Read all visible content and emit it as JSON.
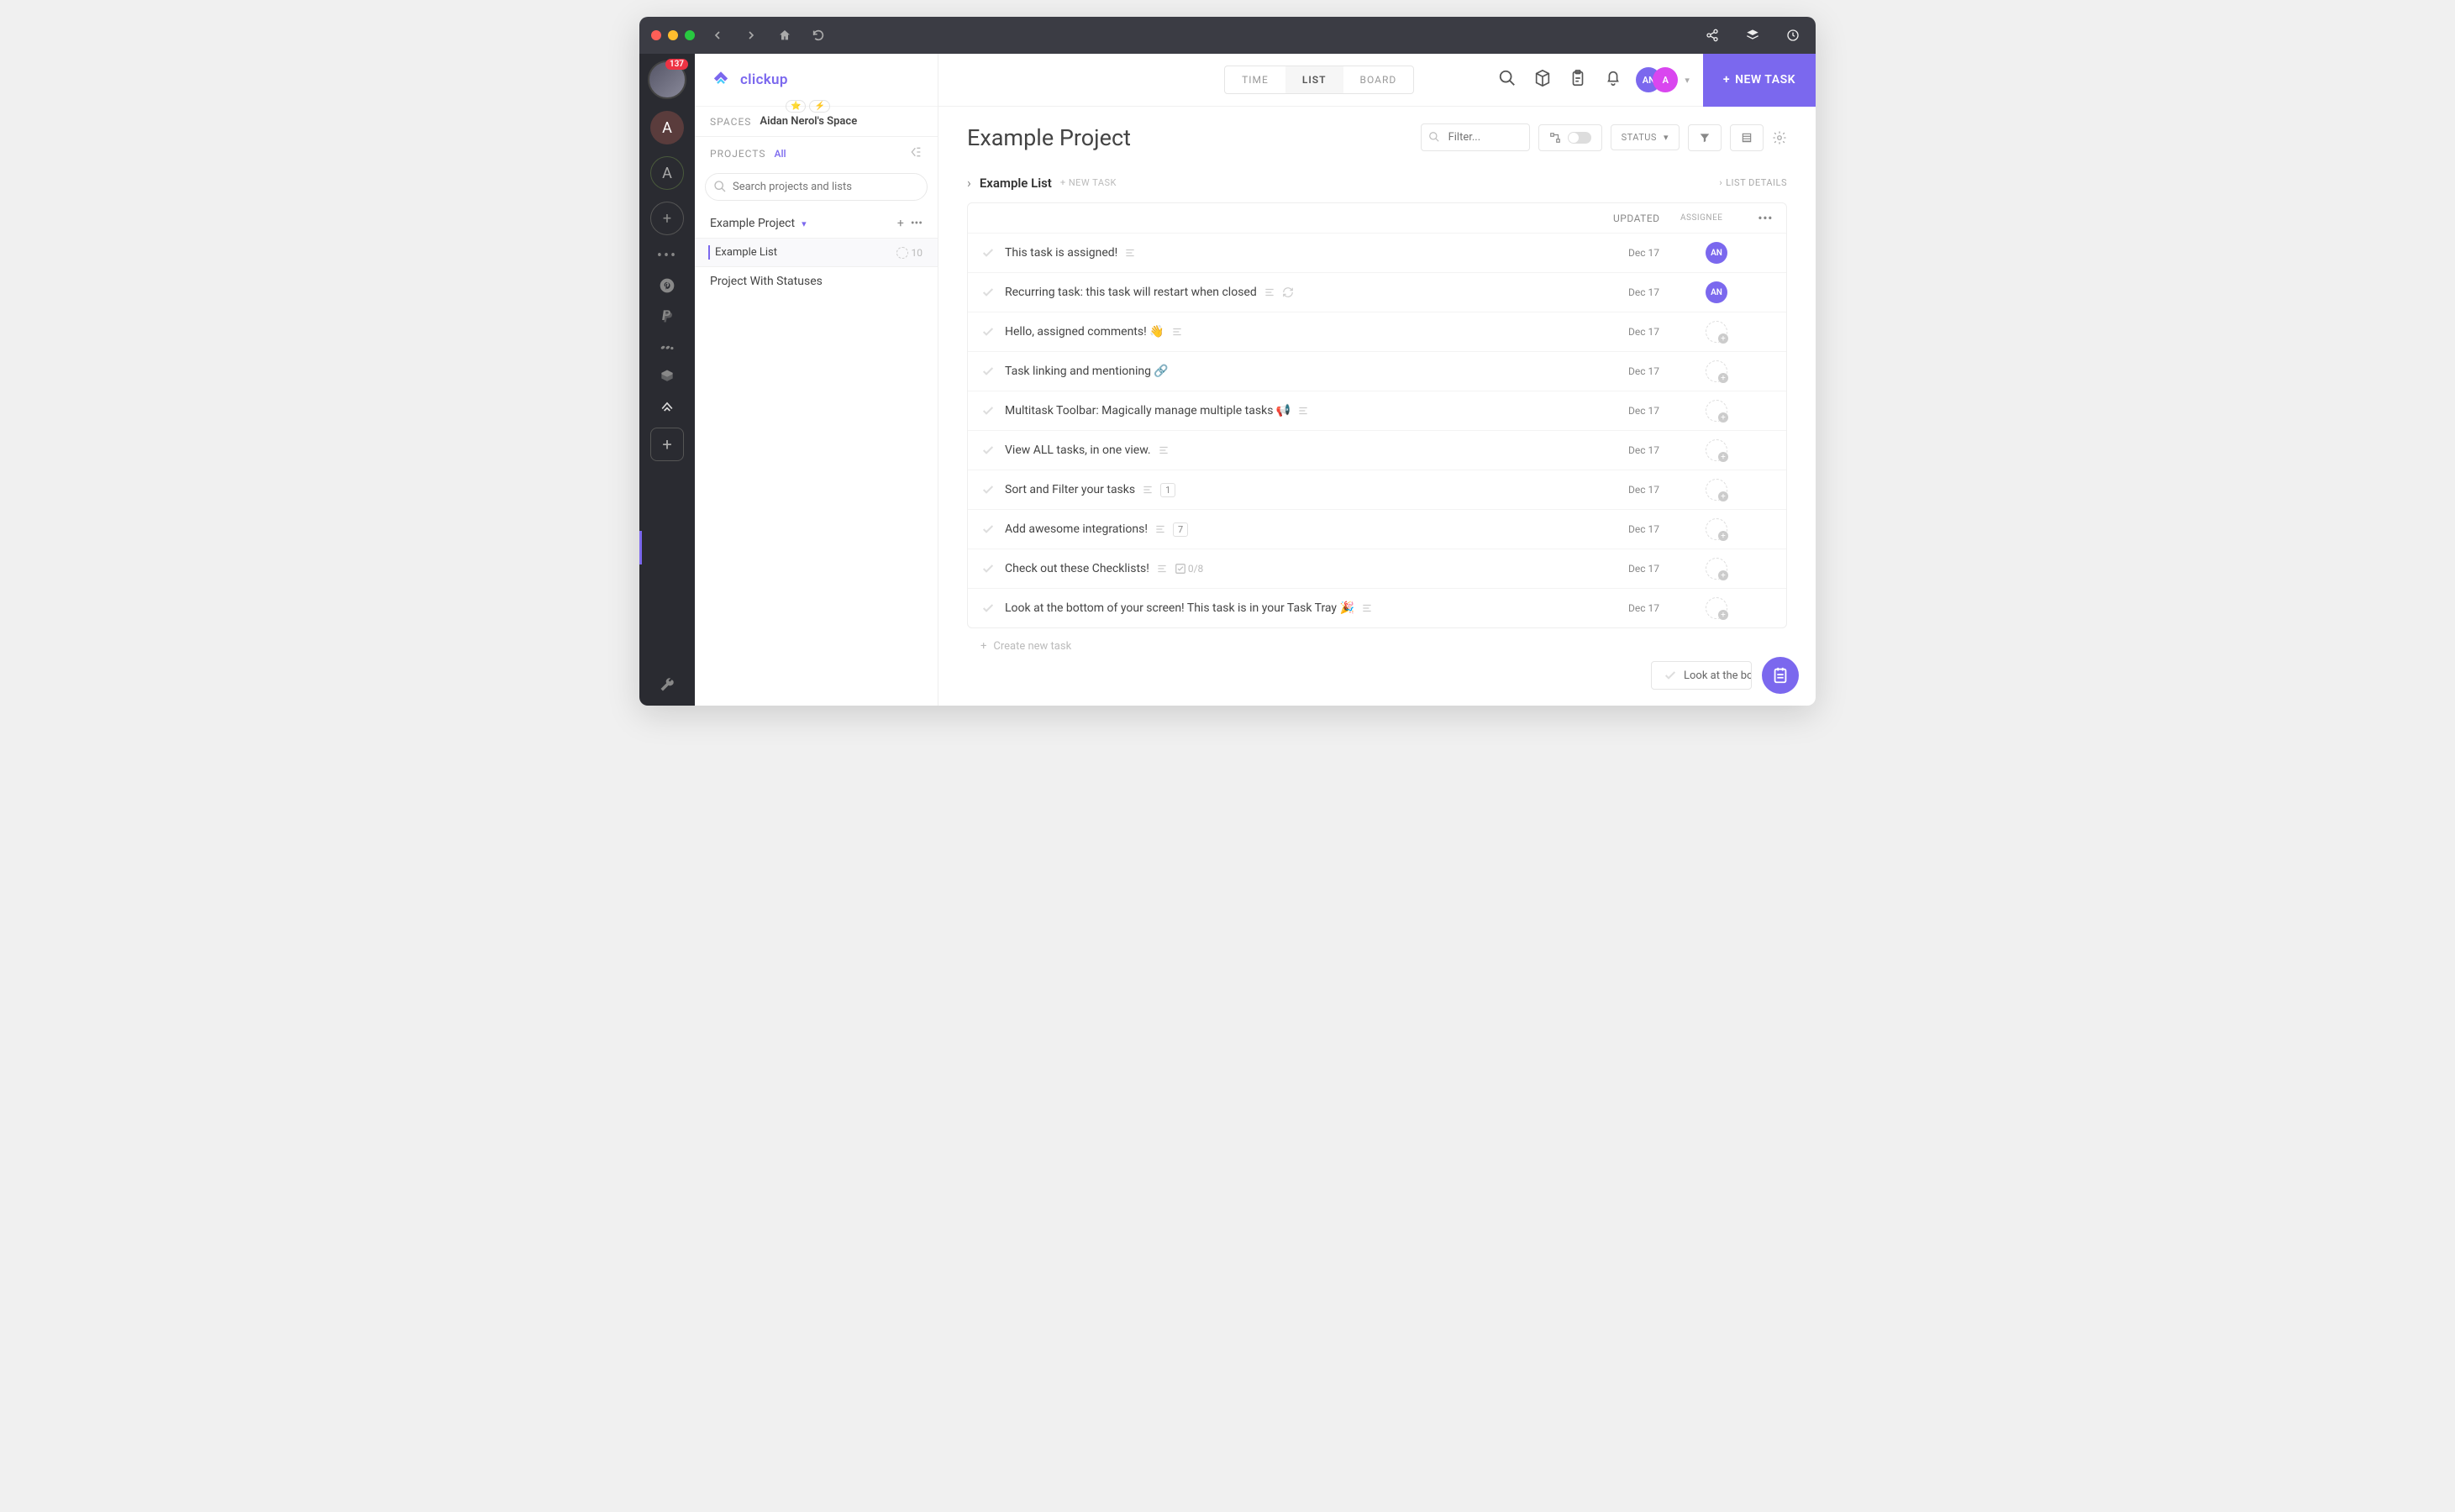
{
  "rail": {
    "badge": "137",
    "letter1": "A",
    "letter2": "A"
  },
  "sidebar": {
    "logo_text": "clickup",
    "spaces_label": "SPACES",
    "space_name": "Aidan Nerol's Space",
    "projects_label": "PROJECTS",
    "all_label": "All",
    "search_placeholder": "Search projects and lists",
    "project1": "Example Project",
    "list1": "Example List",
    "list1_count": "10",
    "project2": "Project With Statuses"
  },
  "topbar": {
    "tab_time": "TIME",
    "tab_list": "LIST",
    "tab_board": "BOARD",
    "user_initials": "AN",
    "user_initials2": "A",
    "new_task": "NEW TASK"
  },
  "page": {
    "title": "Example Project",
    "filter_placeholder": "Filter...",
    "status_label": "STATUS",
    "list_title": "Example List",
    "new_task_label": "+ NEW TASK",
    "list_details": "LIST DETAILS",
    "col_updated": "UPDATED",
    "col_assignee": "ASSIGNEE",
    "create_new": "Create new task",
    "tray_text": "Look at the bo"
  },
  "tasks": [
    {
      "name": "This task is assigned!",
      "date": "Dec 17",
      "assignee": "AN",
      "desc": true
    },
    {
      "name": "Recurring task: this task will restart when closed",
      "date": "Dec 17",
      "assignee": "AN",
      "desc": true,
      "recur": true
    },
    {
      "name": "Hello, assigned comments! 👋",
      "date": "Dec 17",
      "desc": true
    },
    {
      "name": "Task linking and mentioning 🔗",
      "date": "Dec 17"
    },
    {
      "name": "Multitask Toolbar: Magically manage multiple tasks 📢",
      "date": "Dec 17",
      "desc": true
    },
    {
      "name": "View ALL tasks, in one view.",
      "date": "Dec 17",
      "desc": true
    },
    {
      "name": "Sort and Filter your tasks",
      "date": "Dec 17",
      "desc": true,
      "count": "1"
    },
    {
      "name": "Add awesome integrations!",
      "date": "Dec 17",
      "desc": true,
      "count": "7"
    },
    {
      "name": "Check out these Checklists!",
      "date": "Dec 17",
      "desc": true,
      "checklist": "0/8"
    },
    {
      "name": "Look at the bottom of your screen! This task is in your Task Tray 🎉",
      "date": "Dec 17",
      "desc": true
    }
  ]
}
